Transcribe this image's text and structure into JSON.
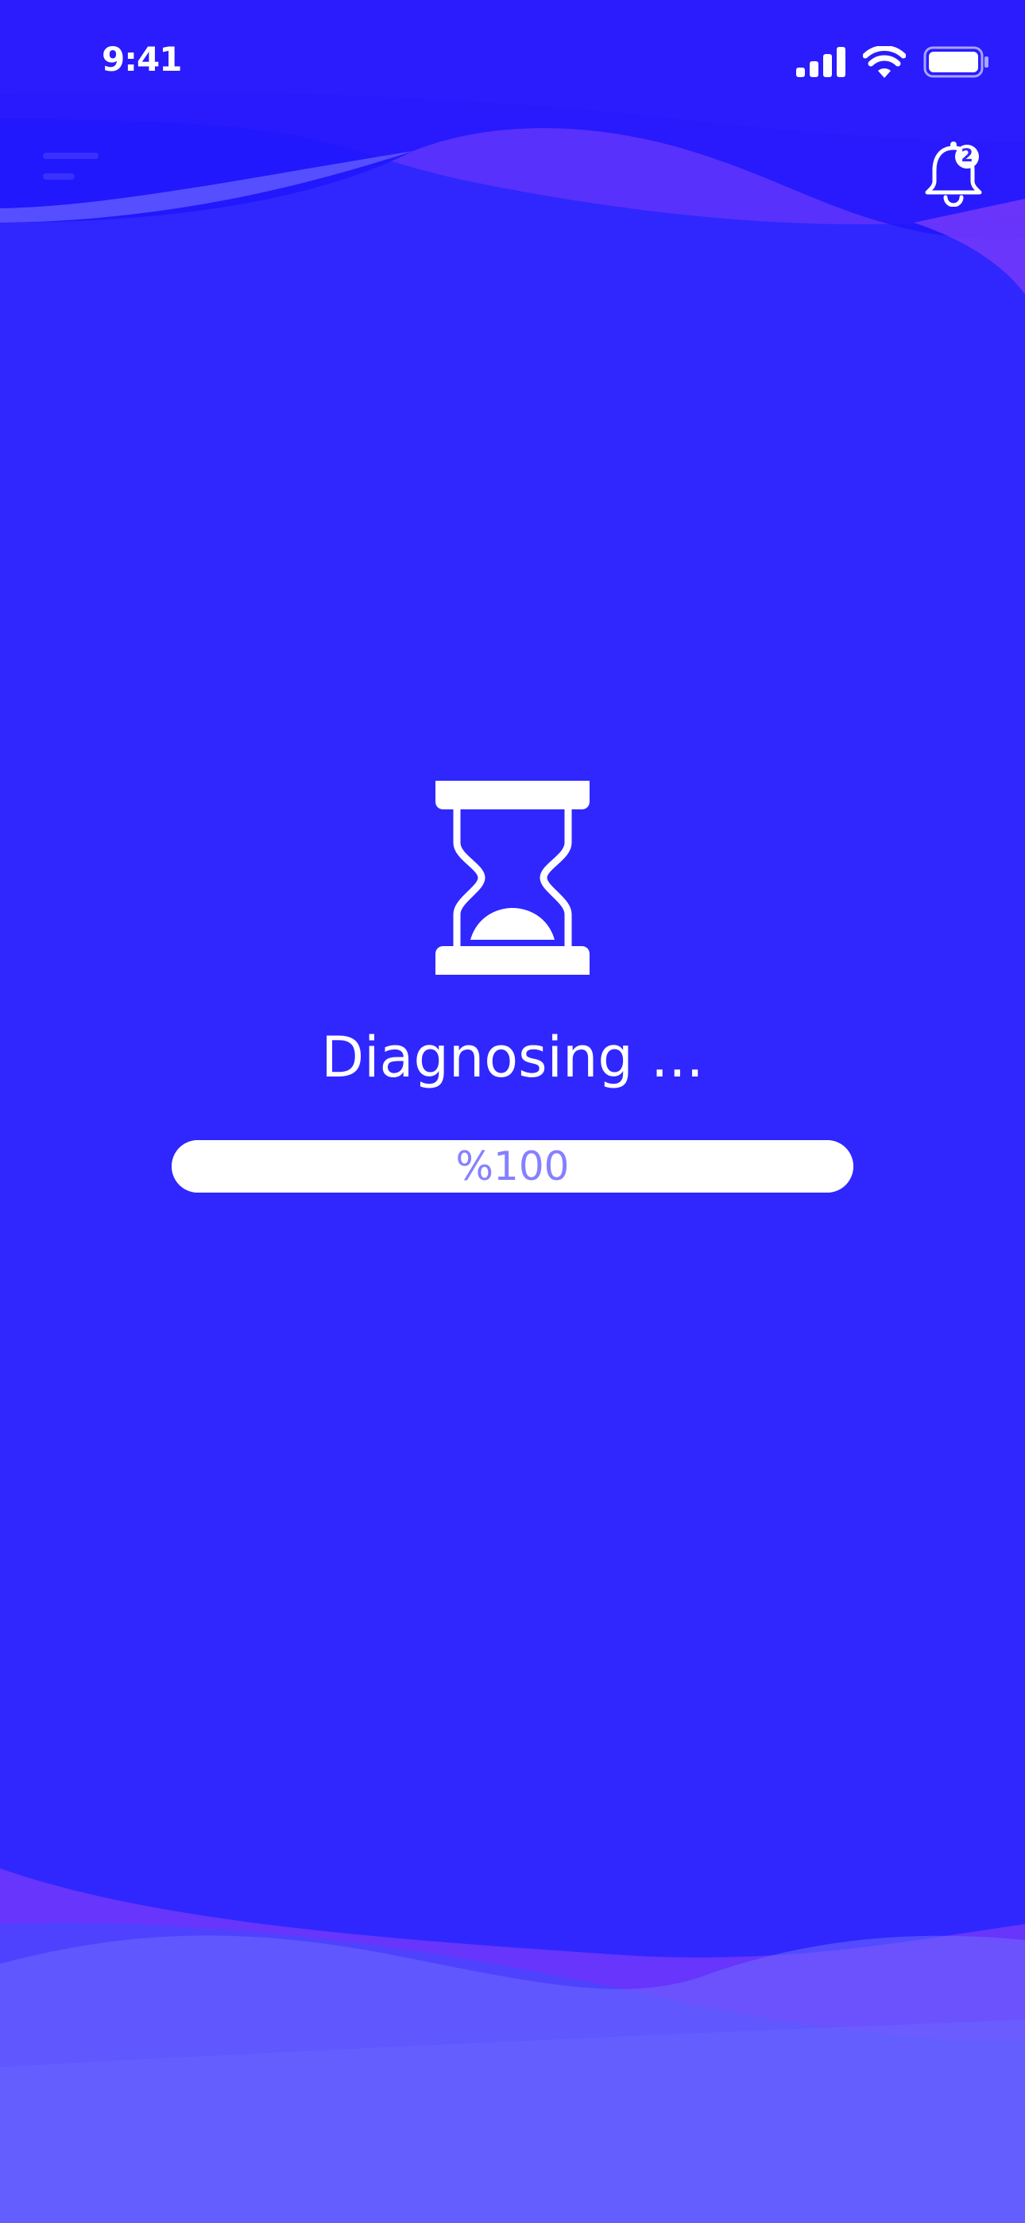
{
  "status_bar": {
    "time": "9:41",
    "signal_icon": "cellular-signal-icon",
    "wifi_icon": "wifi-icon",
    "battery_icon": "battery-icon"
  },
  "header": {
    "menu_icon": "menu-icon",
    "notification_icon": "bell-icon",
    "notification_count": "2"
  },
  "main": {
    "status_icon": "hourglass-icon",
    "title": "Diagnosing ...",
    "progress": {
      "label": "%100",
      "percent": 100
    }
  },
  "colors": {
    "background": "#2f27fe",
    "wave_purple": "#7b3bfa",
    "wave_light": "#6f6aff",
    "progress_text": "#8680ff"
  }
}
